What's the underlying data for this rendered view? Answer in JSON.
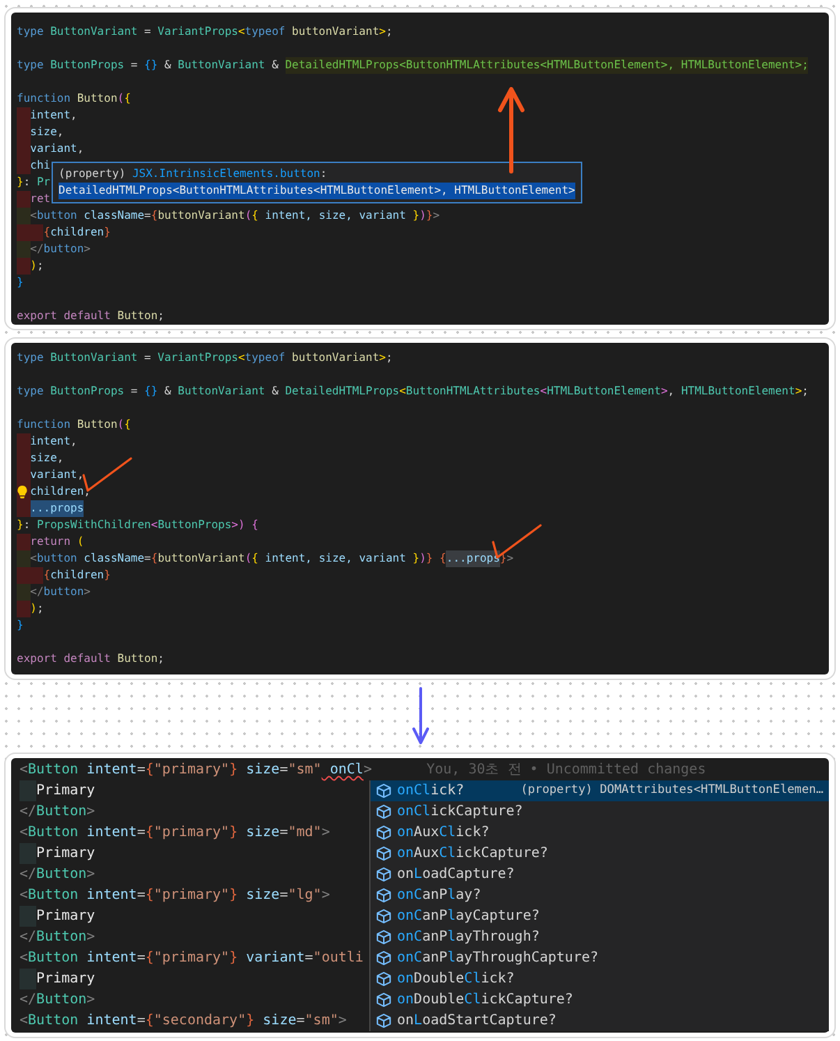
{
  "panels": [
    {
      "kind": "snippet",
      "lines": [
        {
          "tokens": [
            {
              "text": "type ",
              "kind": "kw"
            },
            {
              "text": "ButtonVariant",
              "kind": "type"
            },
            {
              "text": " = ",
              "kind": "p"
            },
            {
              "text": "VariantProps",
              "kind": "type"
            },
            {
              "text": "<",
              "kind": "b1"
            },
            {
              "text": "typeof ",
              "kind": "kw"
            },
            {
              "text": "buttonVariant",
              "kind": "fn"
            },
            {
              "text": ">",
              "kind": "b1"
            },
            {
              "text": ";",
              "kind": "p"
            }
          ]
        },
        {
          "blank_before": true,
          "tokens": [
            {
              "text": "type ",
              "kind": "kw"
            },
            {
              "text": "ButtonProps",
              "kind": "type"
            },
            {
              "text": " = ",
              "kind": "p"
            },
            {
              "text": "{}",
              "kind": "b3"
            },
            {
              "text": " & ",
              "kind": "p"
            },
            {
              "text": "ButtonVariant",
              "kind": "type"
            },
            {
              "text": " & ",
              "kind": "p"
            },
            {
              "text": "DetailedHTMLProps<ButtonHTMLAttributes<HTMLButtonElement>, HTMLButtonElement>;",
              "kind": "green-hover",
              "annotation": {
                "kind": "up-arrow"
              }
            }
          ]
        },
        {
          "blank_before": true,
          "tokens": [
            {
              "text": "function ",
              "kind": "kw"
            },
            {
              "text": "Button",
              "kind": "fn"
            },
            {
              "text": "(",
              "kind": "b2"
            },
            {
              "text": "{",
              "kind": "b1"
            }
          ]
        },
        {
          "guides": [
            {
              "color": "#4a1a1a"
            }
          ],
          "tokens": [
            {
              "text": "intent",
              "kind": "var"
            },
            {
              "text": ",",
              "kind": "p"
            }
          ]
        },
        {
          "guides": [
            {
              "color": "#4a1a1a"
            }
          ],
          "tokens": [
            {
              "text": "size",
              "kind": "var"
            },
            {
              "text": ",",
              "kind": "p"
            }
          ]
        },
        {
          "guides": [
            {
              "color": "#4a1a1a"
            }
          ],
          "tokens": [
            {
              "text": "variant",
              "kind": "var"
            },
            {
              "text": ",",
              "kind": "p"
            }
          ]
        },
        {
          "guides": [
            {
              "color": "#4a1a1a"
            }
          ],
          "tokens": [
            {
              "text": "chi",
              "kind": "var"
            }
          ]
        },
        {
          "tokens": [
            {
              "text": "}",
              "kind": "b1"
            },
            {
              "text": ": ",
              "kind": "p"
            },
            {
              "text": "Pr",
              "kind": "type"
            }
          ]
        },
        {
          "guides": [
            {
              "color": "#4a1a1a"
            }
          ],
          "tokens": [
            {
              "text": "ret",
              "kind": "ctl"
            }
          ]
        },
        {
          "guides": [
            {
              "color": "#2c2c1c"
            }
          ],
          "tokens": [
            {
              "text": "<",
              "kind": "tag"
            },
            {
              "text": "button",
              "kind": "kw"
            },
            {
              "text": " className",
              "kind": "var"
            },
            {
              "text": "=",
              "kind": "p"
            },
            {
              "text": "{",
              "kind": "br"
            },
            {
              "text": "buttonVariant",
              "kind": "fn"
            },
            {
              "text": "(",
              "kind": "b2"
            },
            {
              "text": "{",
              "kind": "b1"
            },
            {
              "text": " intent, size, variant ",
              "kind": "var"
            },
            {
              "text": "}",
              "kind": "b1"
            },
            {
              "text": ")",
              "kind": "b2"
            },
            {
              "text": "}",
              "kind": "br"
            },
            {
              "text": ">",
              "kind": "tag"
            }
          ]
        },
        {
          "guides": [
            {
              "color": "#4a1a1a"
            },
            {
              "color": "#4a1a1a"
            }
          ],
          "tokens": [
            {
              "text": "{",
              "kind": "br"
            },
            {
              "text": "children",
              "kind": "var"
            },
            {
              "text": "}",
              "kind": "br"
            }
          ]
        },
        {
          "guides": [
            {
              "color": "#2c2c1c"
            }
          ],
          "tokens": [
            {
              "text": "</",
              "kind": "tag"
            },
            {
              "text": "button",
              "kind": "kw"
            },
            {
              "text": ">",
              "kind": "tag"
            }
          ]
        },
        {
          "guides": [
            {
              "color": "#4a1a1a"
            }
          ],
          "tokens": [
            {
              "text": ")",
              "kind": "b1"
            },
            {
              "text": ";",
              "kind": "p"
            }
          ]
        },
        {
          "tokens": [
            {
              "text": "}",
              "kind": "b3"
            }
          ]
        },
        {
          "blank_before": true,
          "tokens": [
            {
              "text": "export default ",
              "kind": "ctl"
            },
            {
              "text": "Button",
              "kind": "fn"
            },
            {
              "text": ";",
              "kind": "p"
            }
          ]
        }
      ],
      "hover_card": {
        "lines": [
          {
            "tokens": [
              {
                "text": "(property) ",
                "kind": "p"
              },
              {
                "text": "JSX.IntrinsicElements.button",
                "kind": "b3"
              },
              {
                "text": ":",
                "kind": "p"
              }
            ]
          },
          {
            "tokens": [
              {
                "text": "DetailedHTMLProps<ButtonHTMLAttributes<HTMLButtonElement>, HTMLButtonElement>",
                "kind": "white-selection"
              }
            ]
          }
        ]
      }
    },
    {
      "kind": "snippet",
      "lines": [
        {
          "tokens": [
            {
              "text": "type ",
              "kind": "kw"
            },
            {
              "text": "ButtonVariant",
              "kind": "type"
            },
            {
              "text": " = ",
              "kind": "p"
            },
            {
              "text": "VariantProps",
              "kind": "type"
            },
            {
              "text": "<",
              "kind": "b1"
            },
            {
              "text": "typeof ",
              "kind": "kw"
            },
            {
              "text": "buttonVariant",
              "kind": "fn"
            },
            {
              "text": ">",
              "kind": "b1"
            },
            {
              "text": ";",
              "kind": "p"
            }
          ]
        },
        {
          "blank_before": true,
          "tokens": [
            {
              "text": "type ",
              "kind": "kw"
            },
            {
              "text": "ButtonProps",
              "kind": "type"
            },
            {
              "text": " = ",
              "kind": "p"
            },
            {
              "text": "{}",
              "kind": "b3"
            },
            {
              "text": " & ",
              "kind": "p"
            },
            {
              "text": "ButtonVariant",
              "kind": "type"
            },
            {
              "text": " & ",
              "kind": "p"
            },
            {
              "text": "DetailedHTMLProps",
              "kind": "type"
            },
            {
              "text": "<",
              "kind": "b1"
            },
            {
              "text": "ButtonHTMLAttributes",
              "kind": "type"
            },
            {
              "text": "<",
              "kind": "b2"
            },
            {
              "text": "HTMLButtonElement",
              "kind": "type"
            },
            {
              "text": ">",
              "kind": "b2"
            },
            {
              "text": ", ",
              "kind": "p"
            },
            {
              "text": "HTMLButtonElement",
              "kind": "type"
            },
            {
              "text": ">",
              "kind": "b1"
            },
            {
              "text": ";",
              "kind": "p"
            }
          ]
        },
        {
          "blank_before": true,
          "tokens": [
            {
              "text": "function ",
              "kind": "kw"
            },
            {
              "text": "Button",
              "kind": "fn"
            },
            {
              "text": "(",
              "kind": "b2"
            },
            {
              "text": "{",
              "kind": "b1"
            }
          ]
        },
        {
          "guides": [
            {
              "color": "#4a1a1a"
            }
          ],
          "tokens": [
            {
              "text": "intent",
              "kind": "var"
            },
            {
              "text": ",",
              "kind": "p"
            }
          ]
        },
        {
          "guides": [
            {
              "color": "#4a1a1a"
            }
          ],
          "tokens": [
            {
              "text": "size",
              "kind": "var"
            },
            {
              "text": ",",
              "kind": "p"
            }
          ]
        },
        {
          "guides": [
            {
              "color": "#4a1a1a"
            }
          ],
          "tokens": [
            {
              "text": "variant",
              "kind": "var"
            },
            {
              "text": ",",
              "kind": "p"
            }
          ]
        },
        {
          "guides": [
            {
              "color": "#4a1a1a"
            }
          ],
          "decoration": {
            "kind": "lightbulb"
          },
          "tokens": [
            {
              "text": "children",
              "kind": "var"
            },
            {
              "text": ",",
              "kind": "p",
              "annotation": {
                "kind": "check"
              }
            }
          ]
        },
        {
          "guides": [
            {
              "color": "#4a1a1a"
            }
          ],
          "tokens": [
            {
              "text": "...props",
              "kind": "var-selection"
            }
          ]
        },
        {
          "tokens": [
            {
              "text": "}",
              "kind": "b1"
            },
            {
              "text": ": ",
              "kind": "p"
            },
            {
              "text": "PropsWithChildren",
              "kind": "type"
            },
            {
              "text": "<",
              "kind": "b2"
            },
            {
              "text": "ButtonProps",
              "kind": "type"
            },
            {
              "text": ">",
              "kind": "b2"
            },
            {
              "text": ")",
              "kind": "b2"
            },
            {
              "text": " {",
              "kind": "b2"
            }
          ]
        },
        {
          "guides": [
            {
              "color": "#4a1a1a"
            }
          ],
          "tokens": [
            {
              "text": "return ",
              "kind": "ctl"
            },
            {
              "text": "(",
              "kind": "b1"
            }
          ]
        },
        {
          "guides": [
            {
              "color": "#2c2c1c"
            }
          ],
          "tokens": [
            {
              "text": "<",
              "kind": "tag"
            },
            {
              "text": "button",
              "kind": "kw"
            },
            {
              "text": " className",
              "kind": "var"
            },
            {
              "text": "=",
              "kind": "p"
            },
            {
              "text": "{",
              "kind": "br"
            },
            {
              "text": "buttonVariant",
              "kind": "fn"
            },
            {
              "text": "(",
              "kind": "b2"
            },
            {
              "text": "{",
              "kind": "b1"
            },
            {
              "text": " intent, size, variant ",
              "kind": "var"
            },
            {
              "text": "}",
              "kind": "b1"
            },
            {
              "text": ")",
              "kind": "b2"
            },
            {
              "text": "}",
              "kind": "br"
            },
            {
              "text": " {",
              "kind": "br"
            },
            {
              "text": "...props",
              "kind": "var-reference",
              "annotation": {
                "kind": "check"
              }
            },
            {
              "text": "}",
              "kind": "br"
            },
            {
              "text": ">",
              "kind": "tag"
            }
          ]
        },
        {
          "guides": [
            {
              "color": "#4a1a1a"
            },
            {
              "color": "#4a1a1a"
            }
          ],
          "tokens": [
            {
              "text": "{",
              "kind": "br"
            },
            {
              "text": "children",
              "kind": "var"
            },
            {
              "text": "}",
              "kind": "br"
            }
          ]
        },
        {
          "guides": [
            {
              "color": "#2c2c1c"
            }
          ],
          "tokens": [
            {
              "text": "</",
              "kind": "tag"
            },
            {
              "text": "button",
              "kind": "kw"
            },
            {
              "text": ">",
              "kind": "tag"
            }
          ]
        },
        {
          "guides": [
            {
              "color": "#4a1a1a"
            }
          ],
          "tokens": [
            {
              "text": ")",
              "kind": "b1"
            },
            {
              "text": ";",
              "kind": "p"
            }
          ]
        },
        {
          "tokens": [
            {
              "text": "}",
              "kind": "b3"
            }
          ]
        },
        {
          "blank_before": true,
          "tokens": [
            {
              "text": "export default ",
              "kind": "ctl"
            },
            {
              "text": "Button",
              "kind": "fn"
            },
            {
              "text": ";",
              "kind": "p"
            }
          ]
        }
      ]
    },
    {
      "kind": "closeup",
      "lines": [
        {
          "tokens": [
            {
              "text": "<",
              "kind": "tag"
            },
            {
              "text": "Button",
              "kind": "type"
            },
            {
              "text": " intent",
              "kind": "var"
            },
            {
              "text": "=",
              "kind": "p"
            },
            {
              "text": "{",
              "kind": "br"
            },
            {
              "text": "\"primary\"",
              "kind": "str"
            },
            {
              "text": "}",
              "kind": "br"
            },
            {
              "text": " size",
              "kind": "var"
            },
            {
              "text": "=",
              "kind": "p"
            },
            {
              "text": "\"sm\"",
              "kind": "str"
            },
            {
              "text": " onCl",
              "kind": "var-error"
            },
            {
              "text": ">",
              "kind": "tag"
            },
            {
              "text": "You, 30초 전 • Uncommitted changes",
              "kind": "ghost"
            }
          ]
        },
        {
          "guides": [
            {
              "color": "#263030"
            }
          ],
          "tokens": [
            {
              "text": "Primary",
              "kind": "white"
            }
          ]
        },
        {
          "tokens": [
            {
              "text": "</",
              "kind": "tag"
            },
            {
              "text": "Button",
              "kind": "type"
            },
            {
              "text": ">",
              "kind": "tag"
            }
          ]
        },
        {
          "tokens": [
            {
              "text": "<",
              "kind": "tag"
            },
            {
              "text": "Button",
              "kind": "type"
            },
            {
              "text": " intent",
              "kind": "var"
            },
            {
              "text": "=",
              "kind": "p"
            },
            {
              "text": "{",
              "kind": "br"
            },
            {
              "text": "\"primary\"",
              "kind": "str"
            },
            {
              "text": "}",
              "kind": "br"
            },
            {
              "text": " size",
              "kind": "var"
            },
            {
              "text": "=",
              "kind": "p"
            },
            {
              "text": "\"md\"",
              "kind": "str"
            },
            {
              "text": ">",
              "kind": "tag"
            }
          ]
        },
        {
          "guides": [
            {
              "color": "#263030"
            }
          ],
          "tokens": [
            {
              "text": "Primary",
              "kind": "white"
            }
          ]
        },
        {
          "tokens": [
            {
              "text": "</",
              "kind": "tag"
            },
            {
              "text": "Button",
              "kind": "type"
            },
            {
              "text": ">",
              "kind": "tag"
            }
          ]
        },
        {
          "tokens": [
            {
              "text": "<",
              "kind": "tag"
            },
            {
              "text": "Button",
              "kind": "type"
            },
            {
              "text": " intent",
              "kind": "var"
            },
            {
              "text": "=",
              "kind": "p"
            },
            {
              "text": "{",
              "kind": "br"
            },
            {
              "text": "\"primary\"",
              "kind": "str"
            },
            {
              "text": "}",
              "kind": "br"
            },
            {
              "text": " size",
              "kind": "var"
            },
            {
              "text": "=",
              "kind": "p"
            },
            {
              "text": "\"lg\"",
              "kind": "str"
            },
            {
              "text": ">",
              "kind": "tag"
            }
          ]
        },
        {
          "guides": [
            {
              "color": "#263030"
            }
          ],
          "tokens": [
            {
              "text": "Primary",
              "kind": "white"
            }
          ]
        },
        {
          "tokens": [
            {
              "text": "</",
              "kind": "tag"
            },
            {
              "text": "Button",
              "kind": "type"
            },
            {
              "text": ">",
              "kind": "tag"
            }
          ]
        },
        {
          "tokens": [
            {
              "text": "<",
              "kind": "tag"
            },
            {
              "text": "Button",
              "kind": "type"
            },
            {
              "text": " intent",
              "kind": "var"
            },
            {
              "text": "=",
              "kind": "p"
            },
            {
              "text": "{",
              "kind": "br"
            },
            {
              "text": "\"primary\"",
              "kind": "str"
            },
            {
              "text": "}",
              "kind": "br"
            },
            {
              "text": " variant",
              "kind": "var"
            },
            {
              "text": "=",
              "kind": "p"
            },
            {
              "text": "\"outli",
              "kind": "str"
            }
          ]
        },
        {
          "guides": [
            {
              "color": "#263030"
            }
          ],
          "tokens": [
            {
              "text": "Primary",
              "kind": "white"
            }
          ]
        },
        {
          "tokens": [
            {
              "text": "</",
              "kind": "tag"
            },
            {
              "text": "Button",
              "kind": "type"
            },
            {
              "text": ">",
              "kind": "tag"
            }
          ]
        },
        {
          "tokens": [
            {
              "text": "<",
              "kind": "tag"
            },
            {
              "text": "Button",
              "kind": "type"
            },
            {
              "text": " intent",
              "kind": "var"
            },
            {
              "text": "=",
              "kind": "p"
            },
            {
              "text": "{",
              "kind": "br"
            },
            {
              "text": "\"secondary\"",
              "kind": "str"
            },
            {
              "text": "}",
              "kind": "br"
            },
            {
              "text": " size",
              "kind": "var"
            },
            {
              "text": "=",
              "kind": "p"
            },
            {
              "text": "\"sm\"",
              "kind": "str"
            },
            {
              "text": ">",
              "kind": "tag"
            }
          ]
        }
      ],
      "suggestions": [
        {
          "selected": true,
          "label": [
            {
              "text": "onCl",
              "match": true
            },
            {
              "text": "ick?",
              "match": false
            }
          ],
          "detail": "(property) DOMAttributes<HTMLButtonElemen…"
        },
        {
          "selected": false,
          "label": [
            {
              "text": "onCl",
              "match": true
            },
            {
              "text": "ickCapture?",
              "match": false
            }
          ]
        },
        {
          "selected": false,
          "label": [
            {
              "text": "on",
              "match": true
            },
            {
              "text": "Aux",
              "match": false
            },
            {
              "text": "Cl",
              "match": true
            },
            {
              "text": "ick?",
              "match": false
            }
          ]
        },
        {
          "selected": false,
          "label": [
            {
              "text": "on",
              "match": true
            },
            {
              "text": "Aux",
              "match": false
            },
            {
              "text": "Cl",
              "match": true
            },
            {
              "text": "ickCapture?",
              "match": false
            }
          ]
        },
        {
          "selected": false,
          "label": [
            {
              "text": "on",
              "match": false
            },
            {
              "text": "L",
              "match": true
            },
            {
              "text": "oadCapture?",
              "match": false
            }
          ]
        },
        {
          "selected": false,
          "label": [
            {
              "text": "onC",
              "match": true
            },
            {
              "text": "anP",
              "match": false
            },
            {
              "text": "l",
              "match": true
            },
            {
              "text": "ay?",
              "match": false
            }
          ]
        },
        {
          "selected": false,
          "label": [
            {
              "text": "onC",
              "match": true
            },
            {
              "text": "anP",
              "match": false
            },
            {
              "text": "l",
              "match": true
            },
            {
              "text": "ayCapture?",
              "match": false
            }
          ]
        },
        {
          "selected": false,
          "label": [
            {
              "text": "onC",
              "match": true
            },
            {
              "text": "anP",
              "match": false
            },
            {
              "text": "l",
              "match": true
            },
            {
              "text": "ayThrough?",
              "match": false
            }
          ]
        },
        {
          "selected": false,
          "label": [
            {
              "text": "onC",
              "match": true
            },
            {
              "text": "anP",
              "match": false
            },
            {
              "text": "l",
              "match": true
            },
            {
              "text": "ayThroughCapture?",
              "match": false
            }
          ]
        },
        {
          "selected": false,
          "label": [
            {
              "text": "on",
              "match": true
            },
            {
              "text": "Double",
              "match": false
            },
            {
              "text": "Cl",
              "match": true
            },
            {
              "text": "ick?",
              "match": false
            }
          ]
        },
        {
          "selected": false,
          "label": [
            {
              "text": "on",
              "match": true
            },
            {
              "text": "Double",
              "match": false
            },
            {
              "text": "Cl",
              "match": true
            },
            {
              "text": "ickCapture?",
              "match": false
            }
          ]
        },
        {
          "selected": false,
          "label": [
            {
              "text": "on",
              "match": false
            },
            {
              "text": "L",
              "match": true
            },
            {
              "text": "oadStartCapture?",
              "match": false
            }
          ]
        }
      ]
    }
  ],
  "connector": {
    "kind": "down-arrow"
  }
}
